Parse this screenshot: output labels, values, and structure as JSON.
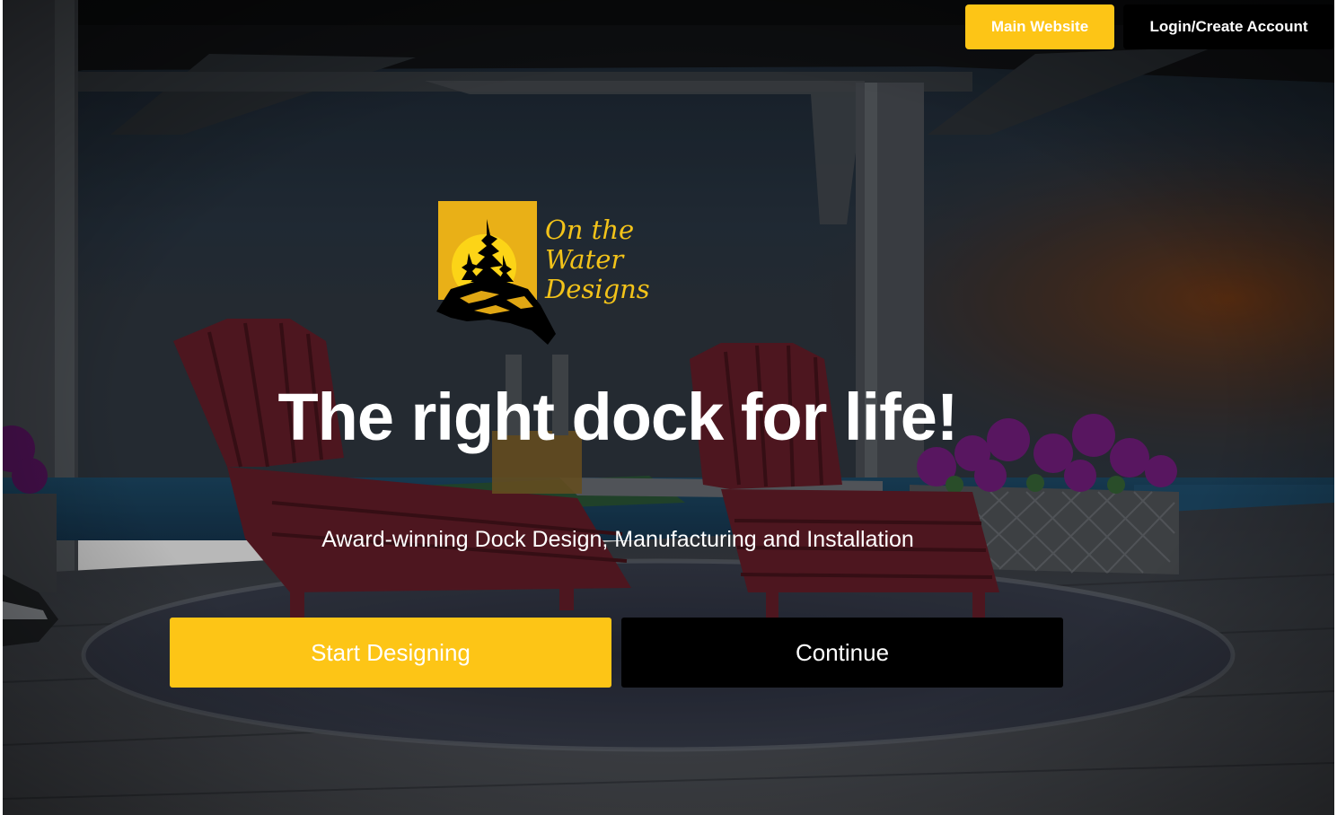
{
  "nav": {
    "main_website_label": "Main Website",
    "login_label": "Login/Create Account"
  },
  "logo": {
    "line1": "On the",
    "line2": "Water",
    "line3": "Designs"
  },
  "hero": {
    "headline": "The right dock for life!",
    "subheadline": "Award-winning Dock Design, Manufacturing and Installation",
    "start_label": "Start Designing",
    "continue_label": "Continue"
  },
  "colors": {
    "accent": "#fdc516",
    "dark": "#000000",
    "text_light": "#ffffff"
  },
  "icons": {
    "logo_mark": "sun-pine-island-icon"
  }
}
